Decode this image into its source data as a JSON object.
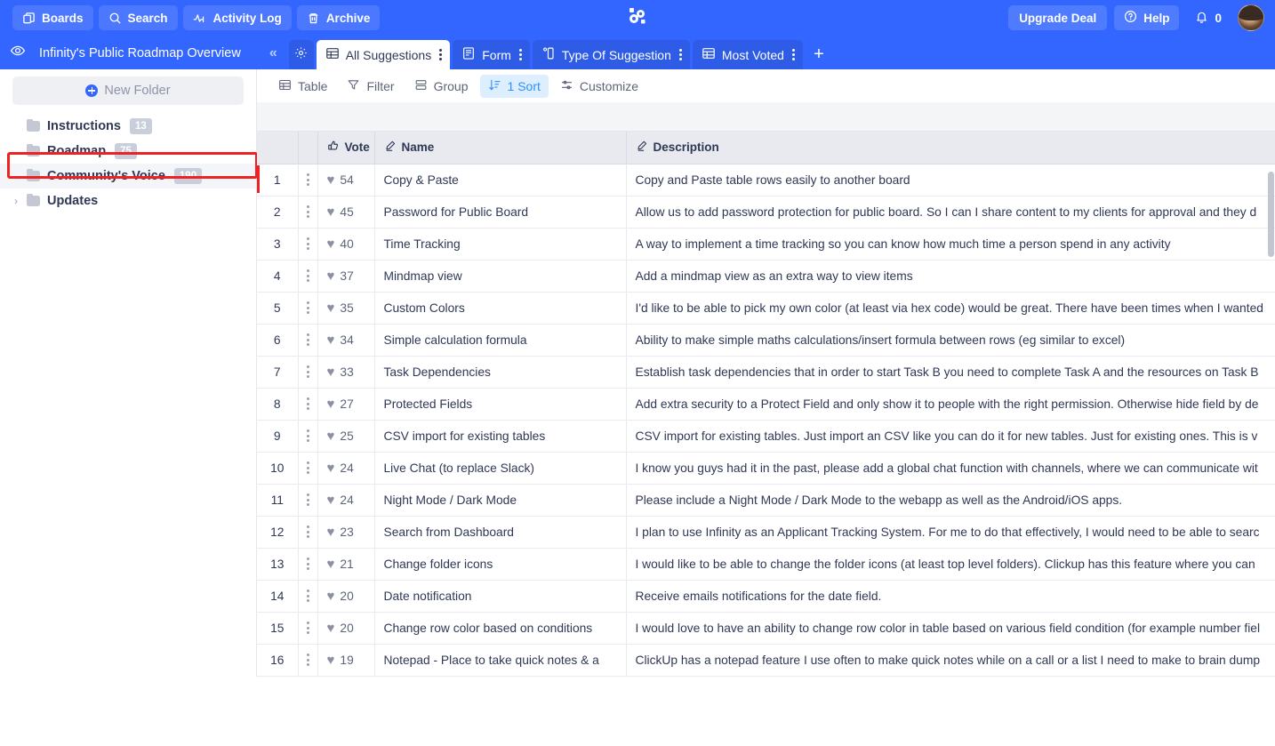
{
  "topbar": {
    "buttons": [
      {
        "label": "Boards",
        "icon": "boards-icon"
      },
      {
        "label": "Search",
        "icon": "search-icon"
      },
      {
        "label": "Activity Log",
        "icon": "activity-log-icon"
      },
      {
        "label": "Archive",
        "icon": "archive-icon"
      }
    ],
    "logo_name": "infinity-logo",
    "upgrade_label": "Upgrade Deal",
    "help_label": "Help",
    "notification_count": "0",
    "avatar_name": "user-avatar",
    "background_color": "#3366ff"
  },
  "tabbar": {
    "eye_icon": "eye-icon",
    "board_title": "Infinity's Public Roadmap Overview",
    "collapse_label": "«",
    "gear_icon": "gear-icon",
    "add_label": "+",
    "tabs": [
      {
        "label": "All Suggestions",
        "icon": "table-view-icon",
        "active": true
      },
      {
        "label": "Form",
        "icon": "form-view-icon",
        "active": false
      },
      {
        "label": "Type Of Suggestion",
        "icon": "column-view-icon",
        "active": false
      },
      {
        "label": "Most Voted",
        "icon": "table-view-icon",
        "active": false
      }
    ]
  },
  "sidebar": {
    "new_folder_label": "New Folder",
    "items": [
      {
        "label": "Instructions",
        "count": "13",
        "expandable": false,
        "selected": false
      },
      {
        "label": "Roadmap",
        "count": "75",
        "expandable": false,
        "selected": false
      },
      {
        "label": "Community's Voice",
        "count": "190",
        "expandable": false,
        "selected": true
      },
      {
        "label": "Updates",
        "count": "",
        "expandable": true,
        "selected": false
      }
    ],
    "highlight_color": "#ee2222"
  },
  "toolbar": {
    "items": [
      {
        "label": "Table",
        "icon": "table-icon",
        "active": false
      },
      {
        "label": "Filter",
        "icon": "filter-icon",
        "active": false
      },
      {
        "label": "Group",
        "icon": "group-icon",
        "active": false
      },
      {
        "label": "1 Sort",
        "icon": "sort-icon",
        "active": true
      },
      {
        "label": "Customize",
        "icon": "customize-icon",
        "active": false
      }
    ],
    "active_color": "#2e90fa"
  },
  "table": {
    "columns": [
      {
        "key": "num",
        "label": ""
      },
      {
        "key": "kebab",
        "label": ""
      },
      {
        "key": "vote",
        "label": "Vote",
        "icon": "thumbs-up-icon"
      },
      {
        "key": "name",
        "label": "Name",
        "icon": "pencil-icon"
      },
      {
        "key": "desc",
        "label": "Description",
        "icon": "pencil-icon"
      }
    ],
    "rows": [
      {
        "num": "1",
        "vote": "54",
        "name": "Copy & Paste",
        "desc": "Copy and Paste table rows easily to another board"
      },
      {
        "num": "2",
        "vote": "45",
        "name": "Password for Public Board",
        "desc": "Allow us to add password protection for public board. So I can I share content to my clients for approval and they d"
      },
      {
        "num": "3",
        "vote": "40",
        "name": "Time Tracking",
        "desc": "A way to implement a time tracking so you can know how much time a person spend in any activity"
      },
      {
        "num": "4",
        "vote": "37",
        "name": "Mindmap view",
        "desc": "Add a mindmap view as an extra way to view items"
      },
      {
        "num": "5",
        "vote": "35",
        "name": "Custom Colors",
        "desc": "I'd like to be able to pick my own color (at least via hex code) would be great. There have been times when I wanted"
      },
      {
        "num": "6",
        "vote": "34",
        "name": "Simple calculation formula",
        "desc": "Ability to make simple maths calculations/insert formula between rows (eg similar to excel)"
      },
      {
        "num": "7",
        "vote": "33",
        "name": "Task Dependencies",
        "desc": "Establish task dependencies that in order to start Task B you need to complete Task A and the resources on Task B"
      },
      {
        "num": "8",
        "vote": "27",
        "name": "Protected Fields",
        "desc": "Add extra security to a Protect Field and only show it to people with the right permission. Otherwise hide field by de"
      },
      {
        "num": "9",
        "vote": "25",
        "name": "CSV import for existing tables",
        "desc": "CSV import for existing tables. Just import an CSV like you can do it for new tables. Just for existing ones. This is v"
      },
      {
        "num": "10",
        "vote": "24",
        "name": "Live Chat (to replace Slack)",
        "desc": "I know you guys had it in the past, please add a global chat function with channels, where we can communicate wit"
      },
      {
        "num": "11",
        "vote": "24",
        "name": "Night Mode / Dark Mode",
        "desc": "Please include a Night Mode / Dark Mode to the webapp as well as the Android/iOS apps."
      },
      {
        "num": "12",
        "vote": "23",
        "name": "Search from Dashboard",
        "desc": "I plan to use Infinity as an Applicant Tracking System. For me to do that effectively, I would need to be able to searc"
      },
      {
        "num": "13",
        "vote": "21",
        "name": "Change folder icons",
        "desc": "I would like to be able to change the folder icons (at least top level folders). Clickup has this feature where you can"
      },
      {
        "num": "14",
        "vote": "20",
        "name": "Date notification",
        "desc": "Receive emails notifications for the date field."
      },
      {
        "num": "15",
        "vote": "20",
        "name": "Change row color based on conditions",
        "desc": "I would love to have an ability to change row color in table based on various field condition (for example number fiel"
      },
      {
        "num": "16",
        "vote": "19",
        "name": "Notepad - Place to take quick notes & a",
        "desc": "ClickUp has a notepad feature I use often to make quick notes while on a call or a list I need to make to brain dump"
      }
    ]
  }
}
